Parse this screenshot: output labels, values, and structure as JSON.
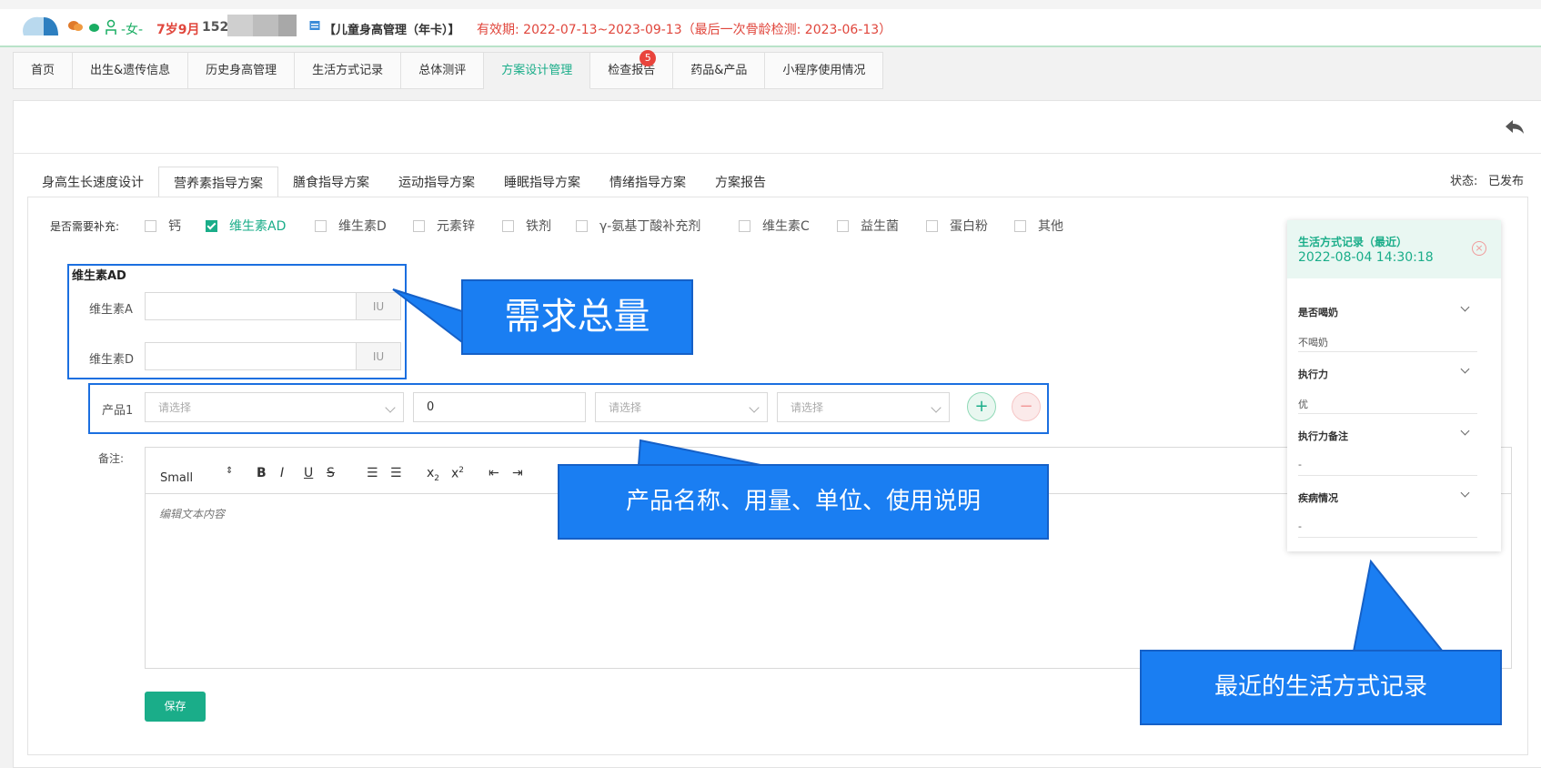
{
  "header": {
    "name": "-女-",
    "age": "7岁9月",
    "phone": "152",
    "plan": "【儿童身高管理（年卡）】",
    "validity": "有效期: 2022-07-13~2023-09-13（最后一次骨龄检测: 2023-06-13）"
  },
  "nav": {
    "tabs": [
      {
        "label": "首页"
      },
      {
        "label": "出生&遗传信息"
      },
      {
        "label": "历史身高管理"
      },
      {
        "label": "生活方式记录"
      },
      {
        "label": "总体测评"
      },
      {
        "label": "方案设计管理"
      },
      {
        "label": "检查报告",
        "badge": "5"
      },
      {
        "label": "药品&产品"
      },
      {
        "label": "小程序使用情况"
      }
    ],
    "active_index": 5
  },
  "subtabs": {
    "items": [
      "身高生长速度设计",
      "营养素指导方案",
      "膳食指导方案",
      "运动指导方案",
      "睡眠指导方案",
      "情绪指导方案",
      "方案报告"
    ],
    "active_index": 1
  },
  "status": {
    "label": "状态:",
    "value": "已发布"
  },
  "supplements": {
    "label": "是否需要补充:",
    "items": [
      {
        "label": "钙",
        "checked": false
      },
      {
        "label": "维生素AD",
        "checked": true
      },
      {
        "label": "维生素D",
        "checked": false
      },
      {
        "label": "元素锌",
        "checked": false
      },
      {
        "label": "铁剂",
        "checked": false
      },
      {
        "label": "γ-氨基丁酸补充剂",
        "checked": false
      },
      {
        "label": "维生素C",
        "checked": false
      },
      {
        "label": "益生菌",
        "checked": false
      },
      {
        "label": "蛋白粉",
        "checked": false
      },
      {
        "label": "其他",
        "checked": false
      }
    ]
  },
  "vitamin_ad": {
    "title": "维生素AD",
    "fields": [
      {
        "label": "维生素A",
        "value": "",
        "unit": "IU"
      },
      {
        "label": "维生素D",
        "value": "",
        "unit": "IU"
      }
    ]
  },
  "product": {
    "label": "产品1",
    "name_placeholder": "请选择",
    "quantity": "0",
    "unit_placeholder": "请选择",
    "usage_placeholder": "请选择",
    "add": "+",
    "remove": "−"
  },
  "notes": {
    "label": "备注:",
    "size_select": "Small",
    "placeholder": "编辑文本内容"
  },
  "save_label": "保存",
  "lifestyle": {
    "title": "生活方式记录（最近）",
    "time": "2022-08-04 14:30:18",
    "close": "×",
    "items": [
      {
        "q": "是否喝奶",
        "a": "不喝奶"
      },
      {
        "q": "执行力",
        "a": "优"
      },
      {
        "q": "执行力备注",
        "a": "-"
      },
      {
        "q": "疾病情况",
        "a": "-"
      }
    ]
  },
  "annotations": {
    "total": "需求总量",
    "product": "产品名称、用量、单位、使用说明",
    "lifestyle": "最近的生活方式记录"
  },
  "colors": {
    "accent": "#1aad89",
    "alert": "#e0463c",
    "annotation": "#1a7ef2"
  }
}
